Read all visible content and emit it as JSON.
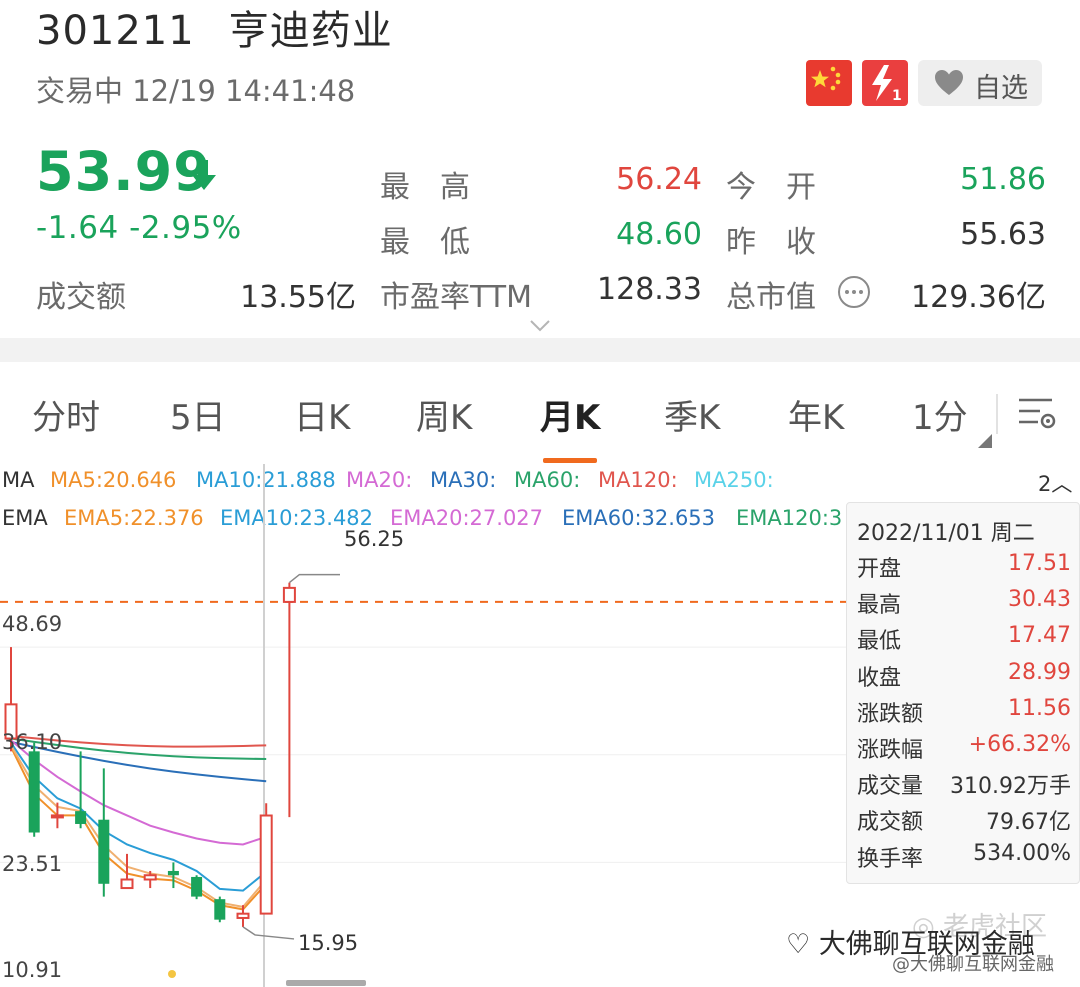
{
  "header": {
    "code": "301211",
    "name": "亨迪药业",
    "status": "交易中 12/19 14:41:48",
    "watch_label": "自选"
  },
  "quote": {
    "price": "53.99",
    "change": "-1.64",
    "change_pct": "-2.95%",
    "turnover_label": "成交额",
    "turnover": "13.55亿",
    "high_label": "最　高",
    "high": "56.24",
    "low_label": "最　低",
    "low": "48.60",
    "pe_label": "市盈率TTM",
    "pe": "128.33",
    "open_label": "今　开",
    "open": "51.86",
    "prev_close_label": "昨　收",
    "prev_close": "55.63",
    "mktcap_label": "总市值",
    "mktcap": "129.36亿"
  },
  "colors": {
    "up": "#e0463e",
    "down": "#1aa35b",
    "accent": "#f06a1e"
  },
  "tabs": [
    {
      "label": "分时"
    },
    {
      "label": "5日"
    },
    {
      "label": "日K"
    },
    {
      "label": "周K"
    },
    {
      "label": "月K",
      "active": true
    },
    {
      "label": "季K"
    },
    {
      "label": "年K"
    },
    {
      "label": "1分"
    }
  ],
  "ma_legend": {
    "prefix": "MA",
    "items": [
      "MA5:20.646",
      "MA10:21.888",
      "MA20:",
      "MA30:",
      "MA60:",
      "MA120:",
      "MA250:"
    ],
    "page": "2"
  },
  "ema_legend": {
    "prefix": "EMA",
    "items": [
      "EMA5:22.376",
      "EMA10:23.482",
      "EMA20:27.027",
      "EMA60:32.653",
      "EMA120:3"
    ]
  },
  "chart_data": {
    "type": "candlestick",
    "y_ticks": [
      "48.69",
      "36.10",
      "23.51",
      "10.91"
    ],
    "max_label": "56.25",
    "min_label": "15.95",
    "candles": [
      {
        "o": 38.0,
        "c": 42.0,
        "h": 48.7,
        "l": 36.5
      },
      {
        "o": 36.5,
        "c": 27.0,
        "h": 37.5,
        "l": 26.5
      },
      {
        "o": 29.0,
        "c": 29.0,
        "h": 30.5,
        "l": 27.5
      },
      {
        "o": 29.5,
        "c": 28.0,
        "h": 36.5,
        "l": 27.5
      },
      {
        "o": 28.5,
        "c": 21.0,
        "h": 34.5,
        "l": 19.5
      },
      {
        "o": 20.5,
        "c": 21.5,
        "h": 24.5,
        "l": 20.5
      },
      {
        "o": 21.5,
        "c": 22.0,
        "h": 22.5,
        "l": 20.5
      },
      {
        "o": 22.5,
        "c": 22.0,
        "h": 23.5,
        "l": 20.5
      },
      {
        "o": 21.8,
        "c": 19.5,
        "h": 22.0,
        "l": 19.2
      },
      {
        "o": 19.2,
        "c": 16.8,
        "h": 19.5,
        "l": 16.5
      },
      {
        "o": 17.0,
        "c": 17.5,
        "h": 18.5,
        "l": 15.95
      },
      {
        "o": 17.51,
        "c": 28.99,
        "h": 30.43,
        "l": 17.47
      },
      {
        "o": 53.99,
        "c": 55.63,
        "h": 56.25,
        "l": 28.8
      }
    ],
    "dashed_level": 53.99,
    "ylim": [
      10.91,
      61.0
    ]
  },
  "tooltip": {
    "date": "2022/11/01 周二",
    "rows": [
      {
        "k": "开盘",
        "v": "17.51",
        "c": "#e0463e"
      },
      {
        "k": "最高",
        "v": "30.43",
        "c": "#e0463e"
      },
      {
        "k": "最低",
        "v": "17.47",
        "c": "#e0463e"
      },
      {
        "k": "收盘",
        "v": "28.99",
        "c": "#e0463e"
      },
      {
        "k": "涨跌额",
        "v": "11.56",
        "c": "#e0463e"
      },
      {
        "k": "涨跌幅",
        "v": "+66.32%",
        "c": "#e0463e"
      },
      {
        "k": "成交量",
        "v": "310.92万手",
        "c": "#333333"
      },
      {
        "k": "成交额",
        "v": "79.67亿",
        "c": "#333333"
      },
      {
        "k": "换手率",
        "v": "534.00%",
        "c": "#333333"
      }
    ]
  },
  "watermark": {
    "brand": "老虎社区",
    "wechat": "大佛聊互联网金融",
    "handle": "@大佛聊互联网金融"
  }
}
